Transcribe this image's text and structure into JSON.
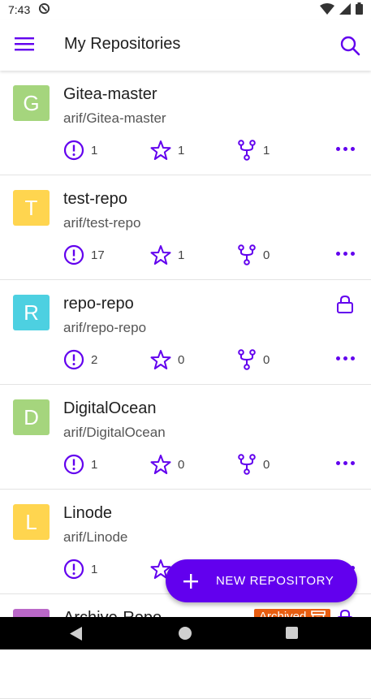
{
  "status_bar": {
    "time": "7:43"
  },
  "app_bar": {
    "title": "My Repositories"
  },
  "colors": {
    "accent": "#6200ee",
    "archived": "#e85d10"
  },
  "repositories": [
    {
      "initial": "G",
      "avatar_color": "#a5d57d",
      "name": "Gitea-master",
      "path": "arif/Gitea-master",
      "issues": "1",
      "stars": "1",
      "forks": "1",
      "locked": false,
      "archived": false
    },
    {
      "initial": "T",
      "avatar_color": "#ffd54f",
      "name": "test-repo",
      "path": "arif/test-repo",
      "issues": "17",
      "stars": "1",
      "forks": "0",
      "locked": false,
      "archived": false
    },
    {
      "initial": "R",
      "avatar_color": "#4dd0e1",
      "name": "repo-repo",
      "path": "arif/repo-repo",
      "issues": "2",
      "stars": "0",
      "forks": "0",
      "locked": true,
      "archived": false
    },
    {
      "initial": "D",
      "avatar_color": "#a5d57d",
      "name": "DigitalOcean",
      "path": "arif/DigitalOcean",
      "issues": "1",
      "stars": "0",
      "forks": "0",
      "locked": false,
      "archived": false
    },
    {
      "initial": "L",
      "avatar_color": "#ffd54f",
      "name": "Linode",
      "path": "arif/Linode",
      "issues": "1",
      "stars": "",
      "forks": "",
      "locked": false,
      "archived": false
    },
    {
      "initial": "",
      "avatar_color": "#ba68c8",
      "name": "Archive-Repo",
      "path": "",
      "issues": "",
      "stars": "",
      "forks": "",
      "locked": true,
      "archived": true,
      "archived_label": "Archived"
    }
  ],
  "fab": {
    "label": "NEW REPOSITORY"
  }
}
